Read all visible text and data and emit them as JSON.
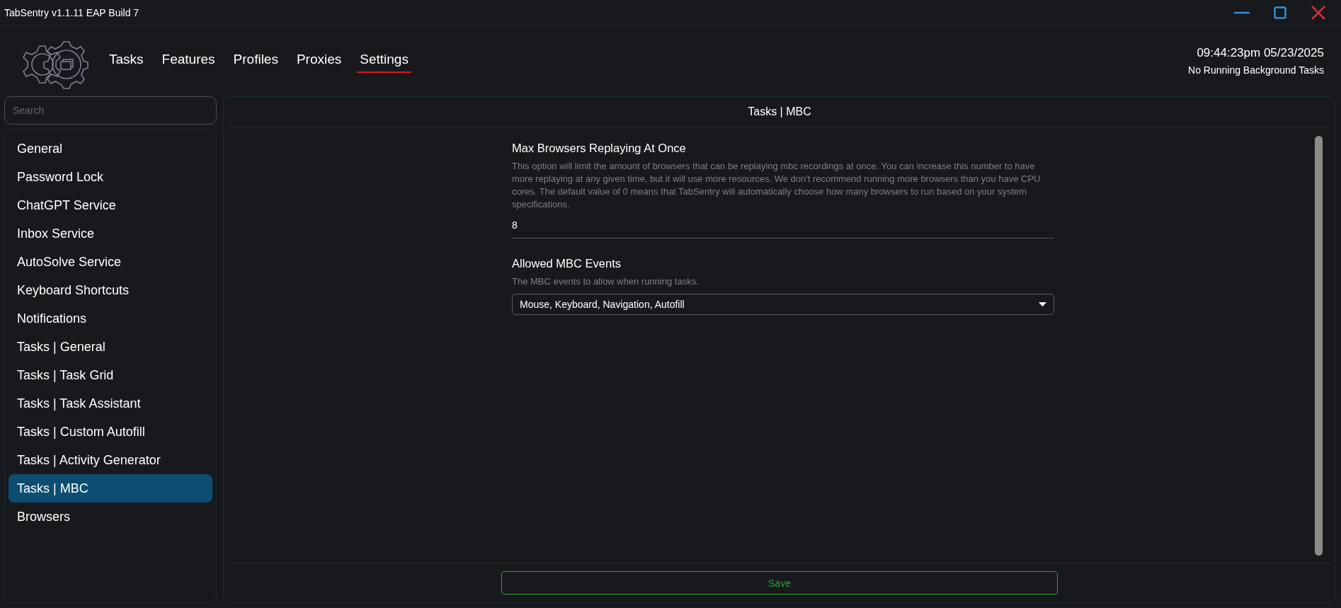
{
  "window": {
    "title": "TabSentry v1.1.11 EAP Build 7"
  },
  "nav": [
    {
      "label": "Tasks",
      "selected": false
    },
    {
      "label": "Features",
      "selected": false
    },
    {
      "label": "Profiles",
      "selected": false
    },
    {
      "label": "Proxies",
      "selected": false
    },
    {
      "label": "Settings",
      "selected": true
    }
  ],
  "clock": "09:44:23pm 05/23/2025",
  "background_status": "No Running Background Tasks",
  "sidebar": {
    "search": {
      "placeholder": "Search"
    },
    "items": [
      {
        "label": "General",
        "selected": false
      },
      {
        "label": "Password Lock",
        "selected": false
      },
      {
        "label": "ChatGPT Service",
        "selected": false
      },
      {
        "label": "Inbox Service",
        "selected": false
      },
      {
        "label": "AutoSolve Service",
        "selected": false
      },
      {
        "label": "Keyboard Shortcuts",
        "selected": false
      },
      {
        "label": "Notifications",
        "selected": false
      },
      {
        "label": "Tasks | General",
        "selected": false
      },
      {
        "label": "Tasks | Task Grid",
        "selected": false
      },
      {
        "label": "Tasks | Task Assistant",
        "selected": false
      },
      {
        "label": "Tasks | Custom Autofill",
        "selected": false
      },
      {
        "label": "Tasks | Activity Generator",
        "selected": false
      },
      {
        "label": "Tasks | MBC",
        "selected": true
      },
      {
        "label": "Browsers",
        "selected": false
      }
    ]
  },
  "panel": {
    "title": "Tasks | MBC",
    "settings": [
      {
        "kind": "input",
        "label": "Max Browsers Replaying At Once",
        "description": "This option will limit the amount of browsers that can be replaying mbc recordings at once. You can increase this number to have more replaying at any given time, but it will use more resources. We don't recommend running more browsers than you have CPU cores. The default value of 0 means that TabSentry will automatically choose how many browsers to run based on your system specifications.",
        "value": "8"
      },
      {
        "kind": "select",
        "label": "Allowed MBC Events",
        "description": "The MBC events to allow when running tasks.",
        "value": "Mouse, Keyboard, Navigation, Autofill"
      }
    ],
    "save_button": "Save"
  }
}
